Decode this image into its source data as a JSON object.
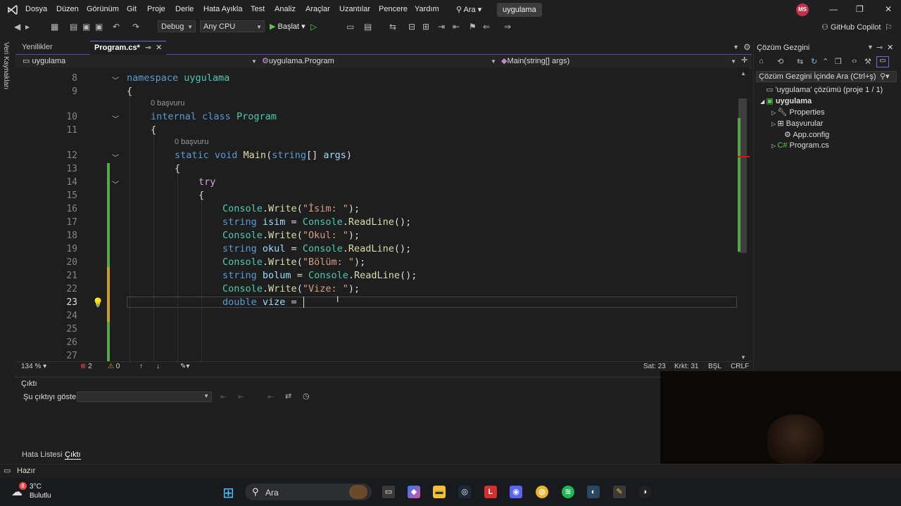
{
  "menu": {
    "items": [
      "Dosya",
      "Düzen",
      "Görünüm",
      "Git",
      "Proje",
      "Derle",
      "Hata Ayıkla",
      "Test",
      "Analiz",
      "Araçlar",
      "Uzantılar",
      "Pencere",
      "Yardım"
    ],
    "search": "Ara",
    "solution_name": "uygulama",
    "avatar_initials": "MS"
  },
  "toolbar": {
    "config": "Debug",
    "platform": "Any CPU",
    "start": "Başlat",
    "copilot": "GitHub Copilot"
  },
  "left_strip": {
    "label": "Veri Kaynakları"
  },
  "tabs": {
    "recent": "Yenilikler",
    "active": "Program.cs*"
  },
  "navbar": {
    "project": "uygulama",
    "class": "uygulama.Program",
    "member": "Main(string[] args)"
  },
  "editor": {
    "line_numbers": [
      "8",
      "9",
      "10",
      "11",
      "12",
      "13",
      "14",
      "15",
      "16",
      "17",
      "18",
      "19",
      "20",
      "21",
      "22",
      "23",
      "24",
      "25",
      "26",
      "27"
    ],
    "current_line": "23",
    "hints": [
      "0 başvuru",
      "0 başvuru"
    ],
    "code": {
      "l8_kw": "namespace",
      "l8_name": " uygulama",
      "brace_open": "{",
      "l10_kw1": "internal",
      "l10_kw2": " class",
      "l10_name": " Program",
      "l12_kw1": "static",
      "l12_kw2": " void",
      "l12_fn": " Main",
      "l12_p1": "(",
      "l12_kw3": "string",
      "l12_p2": "[] ",
      "l12_arg": "args",
      "l12_p3": ")",
      "l14_kw": "try",
      "console": "Console",
      "dot": ".",
      "write": "Write",
      "readline": "ReadLine",
      "paren_open": "(",
      "end_call": "();",
      "end_str": ");",
      "str_isim": "\"İsim: \"",
      "str_okul": "\"Okul: \"",
      "str_bolum": "\"Bölüm: \"",
      "str_vize": "\"Vize: \"",
      "kw_string": "string",
      "kw_double": "double",
      "var_isim": " isim",
      "var_okul": " okul",
      "var_bolum": " bolum",
      "var_vize": " vize",
      "eq": " = "
    }
  },
  "status_line": {
    "zoom": "134 %",
    "errors": "2",
    "warnings": "0",
    "line": "Sat: 23",
    "col": "Krkt: 31",
    "mode": "BŞL",
    "eol": "CRLF"
  },
  "output": {
    "title": "Çıktı",
    "show_label": "Şu çıktıyı göster:",
    "tabs": [
      "Hata Listesi",
      "Çıktı"
    ]
  },
  "solution_explorer": {
    "title": "Çözüm Gezgini",
    "search_placeholder": "Çözüm Gezgini İçinde Ara (Ctrl+ş)",
    "solution_label": "'uygulama' çözümü (proje 1 / 1)",
    "project": "uygulama",
    "children": [
      "Properties",
      "Başvurular",
      "App.config",
      "Program.cs"
    ]
  },
  "statusbar": {
    "text": "Hazır"
  },
  "taskbar": {
    "weather_temp": "3°C",
    "weather_desc": "Bulutlu",
    "weather_badge": "8",
    "search_label": "Ara"
  },
  "colors": {
    "keyword": "#569cd6",
    "type": "#4ec9b0",
    "method": "#dcdcaa",
    "string": "#d69d85",
    "control": "#d8a0df",
    "variable": "#9cdcfe",
    "change_saved": "#57a64a",
    "change_unsaved": "#c7a12b"
  }
}
